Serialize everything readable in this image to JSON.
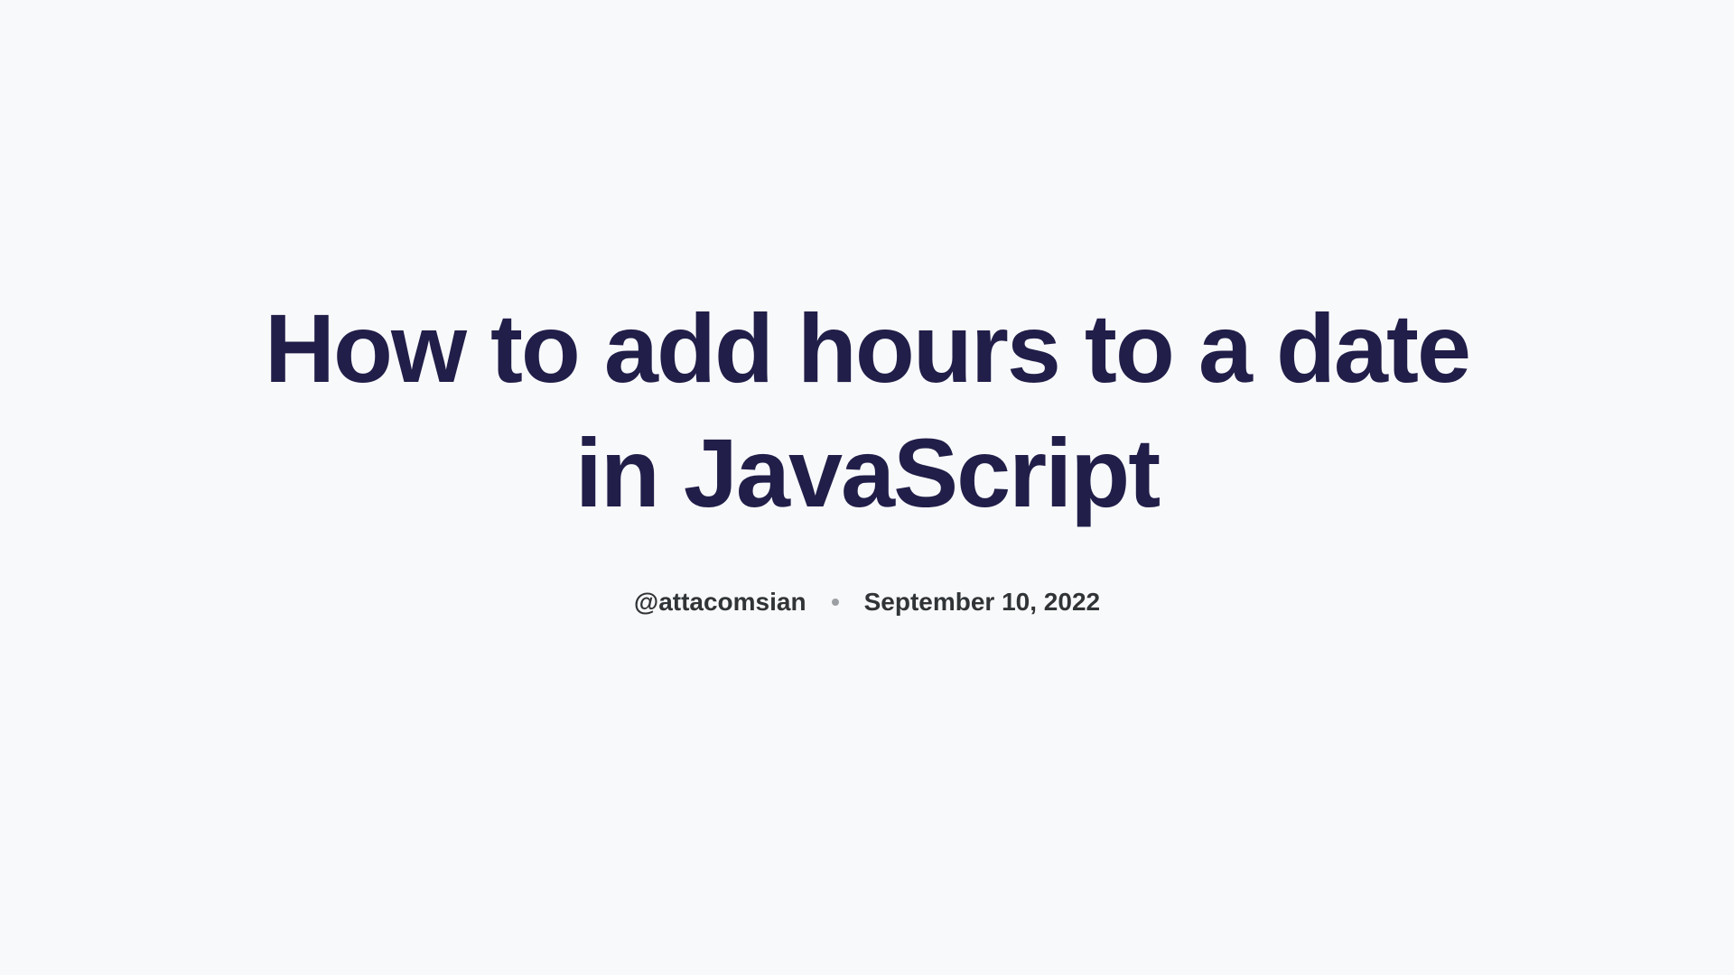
{
  "article": {
    "title": "How to add hours to a date in JavaScript",
    "author": "@attacomsian",
    "date": "September 10, 2022"
  }
}
